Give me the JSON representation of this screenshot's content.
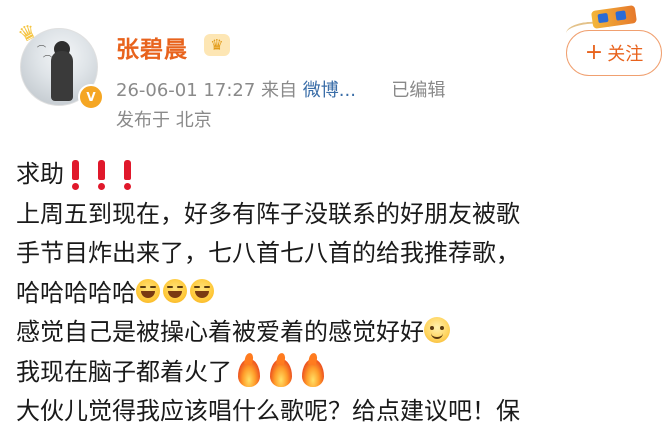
{
  "author": {
    "name": "张碧晨",
    "badge_icon": "crown-icon",
    "avatar_badge_icon": "verified-v-icon",
    "avatar_badge_text": "V"
  },
  "meta": {
    "timestamp": "26-06-01 17:27",
    "source_prefix": "来自",
    "source": "微博...",
    "edited": "已编辑",
    "location": "发布于 北京"
  },
  "follow_button": {
    "plus": "+",
    "label": "关注"
  },
  "post": {
    "line1": "求助",
    "line2": "上周五到现在，好多有阵子没联系的好朋友被歌",
    "line3": "手节目炸出来了，七八首七八首的给我推荐歌，",
    "line4": "哈哈哈哈哈",
    "line5": "感觉自己是被操心着被爱着的感觉好好",
    "line6": "我现在脑子都着火了",
    "line7": "大伙儿觉得我应该唱什么歌呢？给点建议吧！保"
  },
  "colors": {
    "name": "#e8631d",
    "source_link": "#3b6ea8",
    "meta": "#8a8a8a",
    "exclamation": "#e0182b"
  }
}
